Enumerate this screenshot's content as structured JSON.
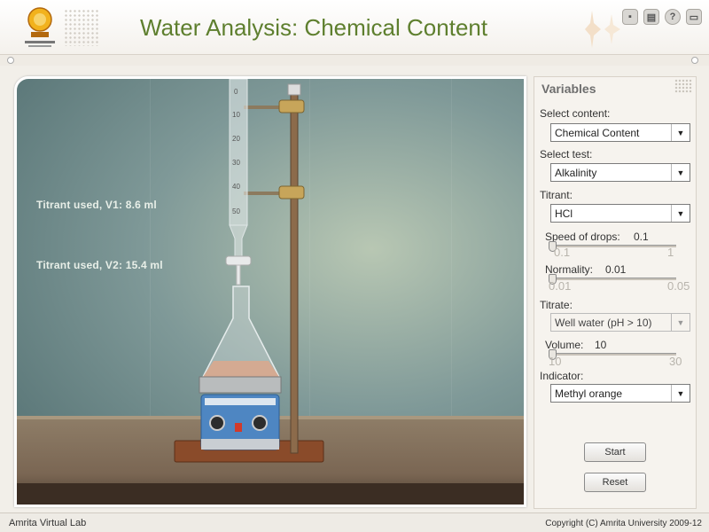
{
  "header": {
    "title": "Water Analysis: Chemical Content",
    "logo_icon": "amrita-university-logo",
    "icons": [
      "save-icon",
      "print-icon",
      "help-icon",
      "fullscreen-icon"
    ]
  },
  "lab": {
    "burette_ticks": [
      "0",
      "10",
      "20",
      "30",
      "40",
      "50"
    ],
    "reading_v1": "Titrant used, V1: 8.6 ml",
    "reading_v2": "Titrant used, V2: 15.4 ml"
  },
  "variables": {
    "title": "Variables",
    "select_content": {
      "label": "Select content:",
      "value": "Chemical Content"
    },
    "select_test": {
      "label": "Select test:",
      "value": "Alkalinity"
    },
    "titrant": {
      "label": "Titrant:",
      "value": "HCl"
    },
    "speed_of_drops": {
      "label": "Speed of drops:",
      "value": "0.1",
      "min": "0.1",
      "max": "1",
      "level": 0.0
    },
    "normality": {
      "label": "Normality:",
      "value": "0.01",
      "min": "0.01",
      "max": "0.05",
      "level": 0.0
    },
    "titrate": {
      "label": "Titrate:",
      "value": "Well water (pH > 10)"
    },
    "volume": {
      "label": "Volume:",
      "value": "10",
      "min": "10",
      "max": "30",
      "level": 0.0
    },
    "indicator": {
      "label": "Indicator:",
      "value": "Methyl orange"
    },
    "start_label": "Start",
    "reset_label": "Reset"
  },
  "footer": {
    "left": "Amrita Virtual Lab",
    "right": "Copyright (C) Amrita University 2009-12"
  },
  "colors": {
    "title": "#5e7f2e",
    "lab_background": "#7f9998",
    "liquid": "#d9a98e"
  }
}
